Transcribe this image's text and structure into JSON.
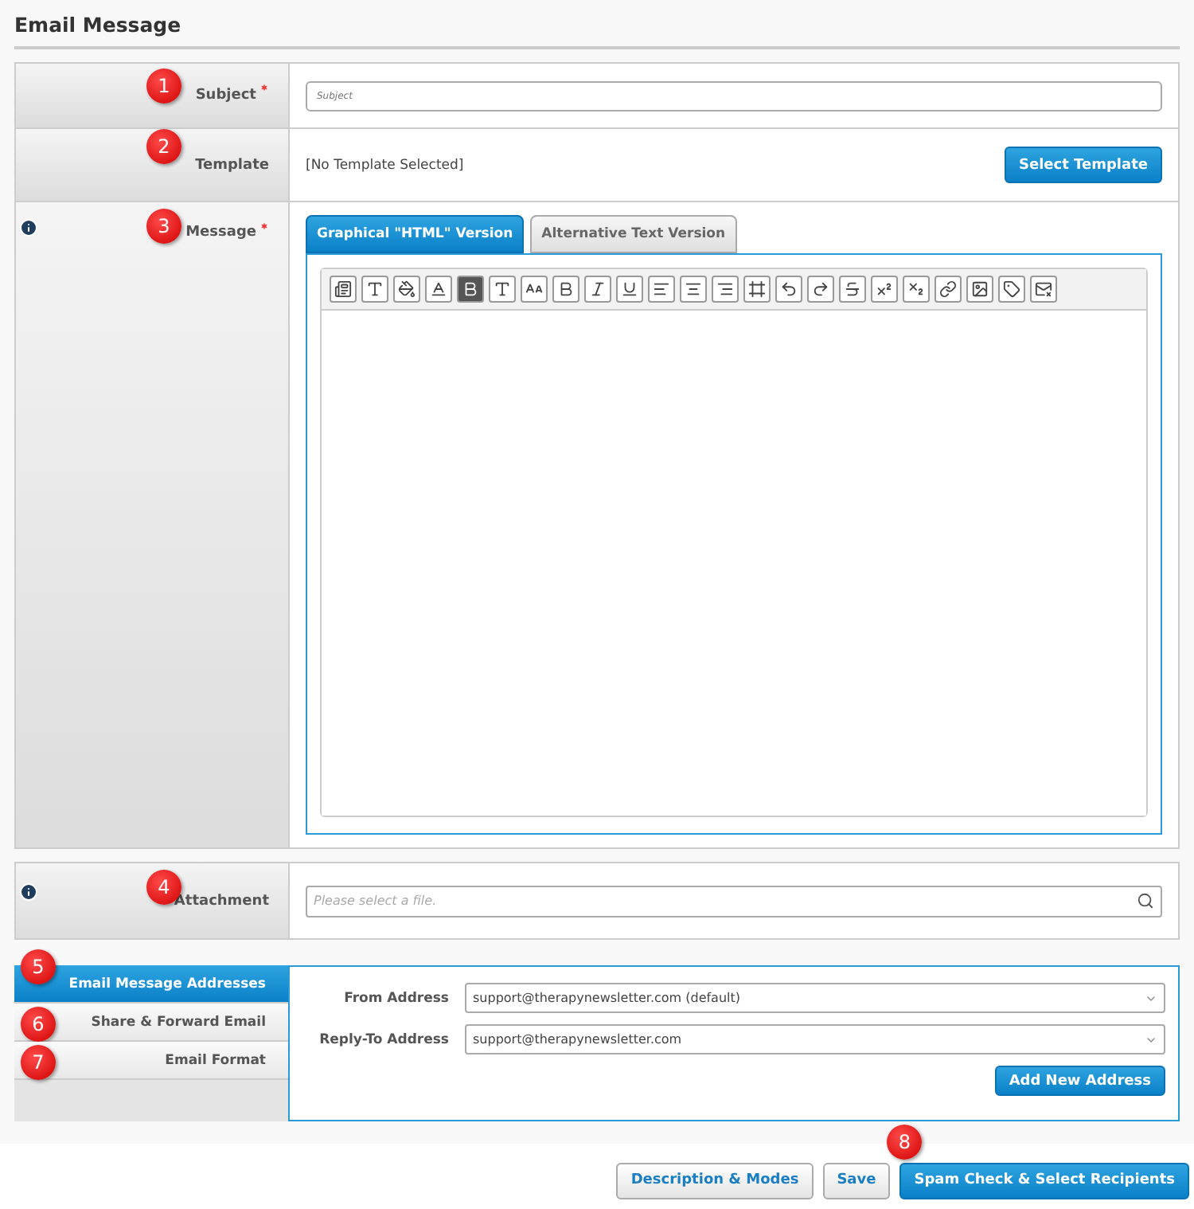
{
  "title": "Email Message",
  "subject": {
    "marker": "1",
    "label": "Subject",
    "required": true,
    "placeholder": "Subject"
  },
  "template": {
    "marker": "2",
    "label": "Template",
    "value": "[No Template Selected]",
    "button": "Select Template"
  },
  "message": {
    "marker": "3",
    "label": "Message",
    "required": true,
    "info": true,
    "tabs": [
      {
        "label": "Graphical \"HTML\" Version",
        "selected": true
      },
      {
        "label": "Alternative Text Version",
        "selected": false
      }
    ]
  },
  "attachment": {
    "marker": "4",
    "label": "Attachment",
    "info": true,
    "placeholder": "Please select a file."
  },
  "address_panel": {
    "tabs": [
      {
        "marker": "5",
        "label": "Email Message Addresses",
        "selected": true
      },
      {
        "marker": "6",
        "label": "Share & Forward Email",
        "selected": false
      },
      {
        "marker": "7",
        "label": "Email Format",
        "selected": false
      }
    ],
    "fields": [
      {
        "label": "From Address",
        "value": "support@therapynewsletter.com (default)"
      },
      {
        "label": "Reply-To Address",
        "value": "support@therapynewsletter.com"
      }
    ],
    "button": "Add New Address"
  },
  "footer": {
    "marker": "8",
    "buttons": [
      {
        "label": "Description & Modes",
        "kind": "secondary"
      },
      {
        "label": "Save",
        "kind": "secondary"
      },
      {
        "label": "Spam Check & Select Recipients",
        "kind": "primary"
      }
    ]
  }
}
